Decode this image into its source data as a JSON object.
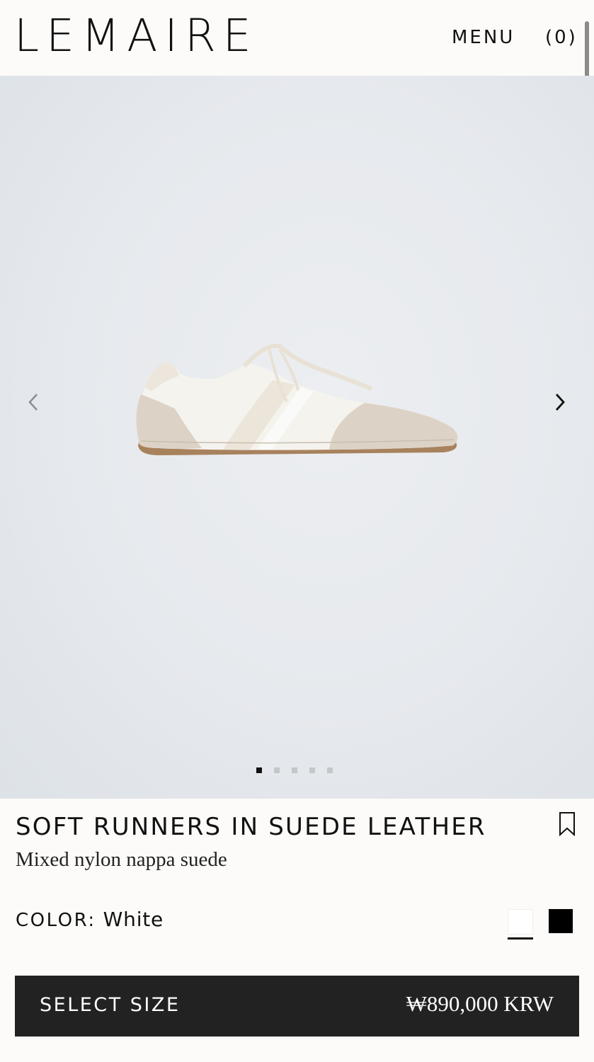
{
  "header": {
    "logo": "LEMAIRE",
    "menu_label": "MENU",
    "cart_label": "(0)"
  },
  "gallery": {
    "image_count": 5,
    "active_index": 0
  },
  "product": {
    "title": "SOFT RUNNERS IN SUEDE LEATHER",
    "subtitle": "Mixed nylon nappa suede",
    "color_label": "COLOR:",
    "color_value": "White",
    "swatches": [
      {
        "name": "White",
        "hex": "#ffffff",
        "selected": true
      },
      {
        "name": "Black",
        "hex": "#000000",
        "selected": false
      }
    ]
  },
  "purchase": {
    "select_size_label": "SELECT SIZE",
    "price": "₩890,000 KRW"
  },
  "colors": {
    "background": "#fcfbf9",
    "gallery_bg": "#e6e9ed",
    "button_bg": "#222222",
    "text": "#111111"
  },
  "icons": {
    "prev": "chevron-left-icon",
    "next": "chevron-right-icon",
    "bookmark": "bookmark-icon"
  }
}
